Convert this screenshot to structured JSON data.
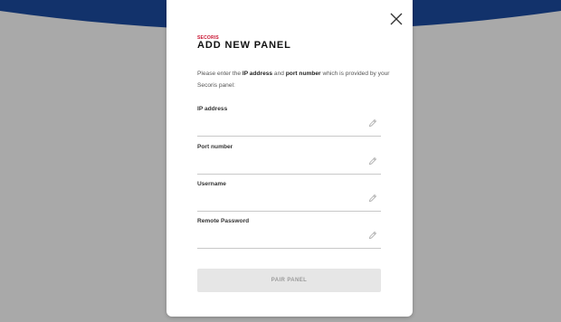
{
  "brand": "SECORIS",
  "title": "ADD NEW PANEL",
  "instructions": {
    "prefix": "Please enter the ",
    "bold1": "IP address",
    "middle": " and ",
    "bold2": "port number",
    "suffix": " which is provided by your Secoris panel:"
  },
  "fields": [
    {
      "label": "IP address",
      "value": ""
    },
    {
      "label": "Port number",
      "value": ""
    },
    {
      "label": "Username",
      "value": ""
    },
    {
      "label": "Remote Password",
      "value": ""
    }
  ],
  "pair_button": {
    "label": "PAIR PANEL",
    "enabled": false
  },
  "close_icon": "close-icon",
  "edit_icon": "pencil-icon",
  "colors": {
    "brand_accent": "#c8102e",
    "backdrop_gray": "#a9a9a9",
    "backdrop_band_blue": "#12326b",
    "button_disabled_bg": "#e6e6e6",
    "button_disabled_text": "#9a9a9a"
  }
}
